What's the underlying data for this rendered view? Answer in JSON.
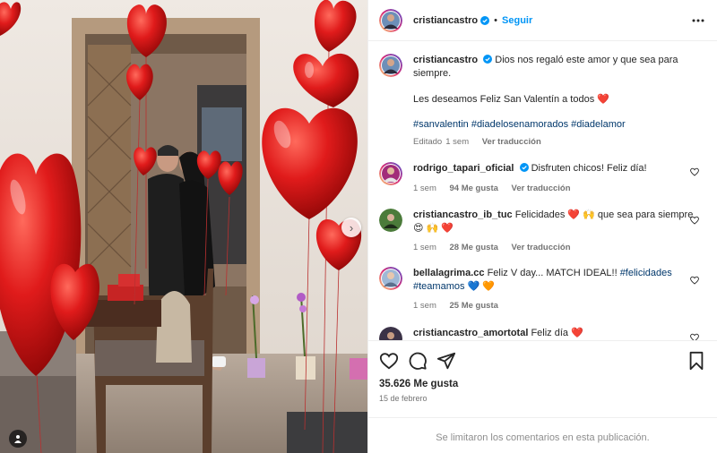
{
  "post": {
    "username": "cristiancastro",
    "follow_label": "Seguir",
    "dot": "•"
  },
  "caption": {
    "username": "cristiancastro",
    "line1": "Dios nos regaló este amor y que sea para siempre.",
    "line2": "Les deseamos Feliz San Valentín a todos",
    "line2_emoji": "❤️",
    "hashtags": "#sanvalentin #diadelosenamorados #diadelamor",
    "edited": "Editado",
    "time": "1 sem",
    "translate": "Ver traducción"
  },
  "comments": [
    {
      "username": "rodrigo_tapari_oficial",
      "verified": true,
      "text": "Disfruten chicos! Feliz día!",
      "time": "1 sem",
      "likes": "94 Me gusta",
      "translate": "Ver traducción"
    },
    {
      "username": "cristiancastro_ib_tuc",
      "verified": false,
      "text": "Felicidades ❤️ 🙌 que sea para siempre",
      "text2": "😍 🙌 ❤️",
      "time": "1 sem",
      "likes": "28 Me gusta",
      "translate": "Ver traducción"
    },
    {
      "username": "bellalagrima.cc",
      "verified": false,
      "text": "Feliz V day... MATCH IDEAL!! ",
      "hashtag1": "#felicidades",
      "hashtag2": "#teamamos",
      "text2": "💙 🧡",
      "time": "1 sem",
      "likes": "25 Me gusta"
    },
    {
      "username": "cristiancastro_amortotal",
      "verified": false,
      "text": "Feliz día ❤️"
    }
  ],
  "stats": {
    "likes": "35.626 Me gusta",
    "date": "15 de febrero"
  },
  "footer": {
    "comments_closed": "Se limitaron los comentarios en esta publicación."
  },
  "icons": {
    "verified": "verified-badge-icon",
    "like": "heart-icon",
    "comment": "comment-icon",
    "share": "share-icon",
    "save": "bookmark-icon",
    "more": "more-horizontal-icon",
    "next": "chevron-right-icon",
    "tag": "user-tag-icon"
  },
  "colors": {
    "link": "#0095f6",
    "hashtag": "#00376b",
    "verified": "#0095f6",
    "balloon": "#d81b1b"
  }
}
